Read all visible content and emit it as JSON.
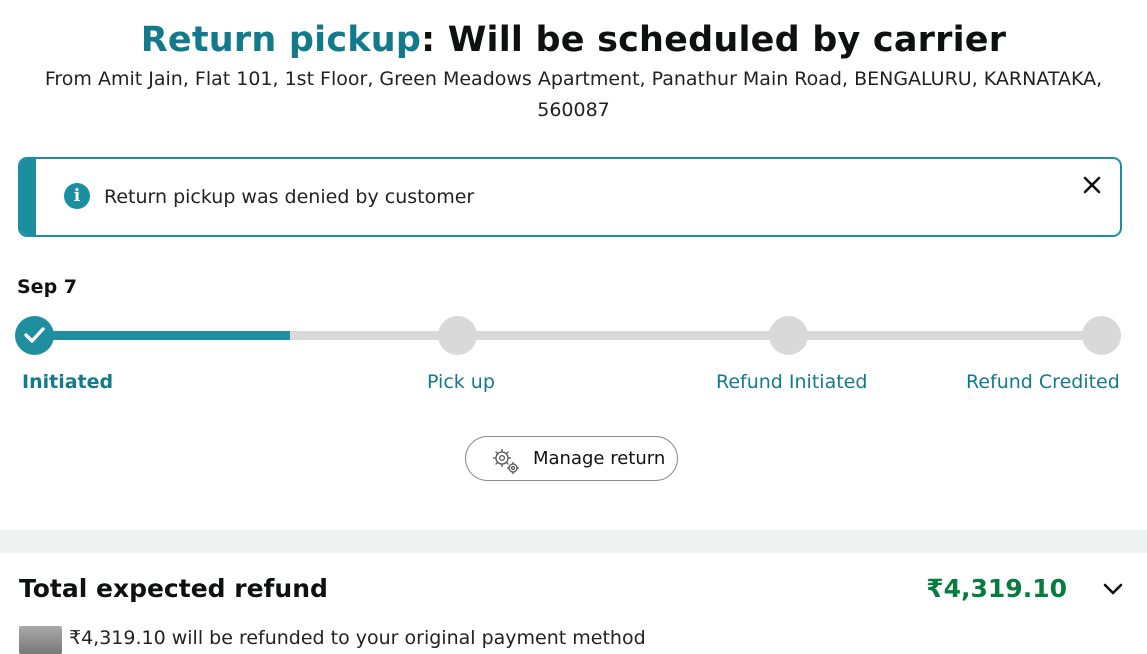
{
  "header": {
    "title_accent": "Return pickup",
    "title_rest": ": Will be scheduled by carrier",
    "address": "From Amit Jain, Flat 101, 1st Floor, Green Meadows Apartment, Panathur Main Road, BENGALURU, KARNATAKA, 560087"
  },
  "alert": {
    "icon": "info-icon",
    "message": "Return pickup was denied by customer",
    "close_glyph": "✕"
  },
  "progress": {
    "date": "Sep 7",
    "completed_fraction": 0.24,
    "steps": [
      {
        "label": "Initiated",
        "state": "done"
      },
      {
        "label": "Pick up",
        "state": "pending"
      },
      {
        "label": "Refund Initiated",
        "state": "pending"
      },
      {
        "label": "Refund Credited",
        "state": "pending"
      }
    ]
  },
  "actions": {
    "manage_return": "Manage return"
  },
  "refund": {
    "title": "Total expected refund",
    "amount": "₹4,319.10",
    "note": "₹4,319.10 will be refunded to your original payment method"
  },
  "colors": {
    "accent": "#137a8c",
    "track": "#d9d9d9",
    "refund_green": "#067d3f"
  }
}
